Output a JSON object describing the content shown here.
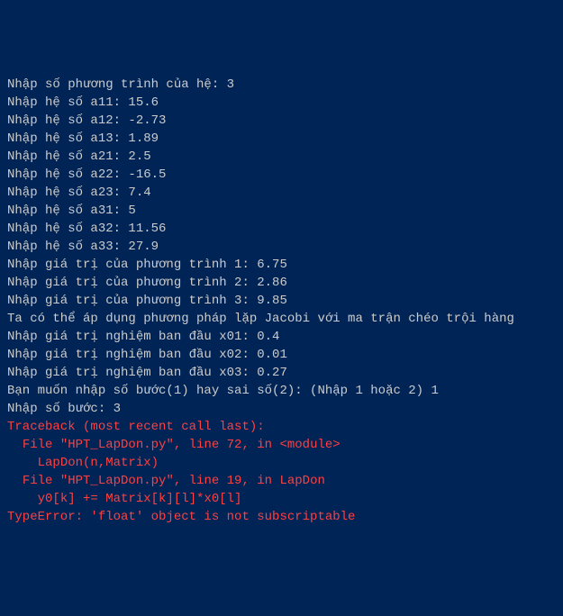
{
  "lines": [
    {
      "text": "Nhập số phương trình của hệ: 3",
      "color": "normal"
    },
    {
      "text": "Nhập hệ số a11: 15.6",
      "color": "normal"
    },
    {
      "text": "Nhập hệ số a12: -2.73",
      "color": "normal"
    },
    {
      "text": "Nhập hệ số a13: 1.89",
      "color": "normal"
    },
    {
      "text": "Nhập hệ số a21: 2.5",
      "color": "normal"
    },
    {
      "text": "Nhập hệ số a22: -16.5",
      "color": "normal"
    },
    {
      "text": "Nhập hệ số a23: 7.4",
      "color": "normal"
    },
    {
      "text": "Nhập hệ số a31: 5",
      "color": "normal"
    },
    {
      "text": "Nhập hệ số a32: 11.56",
      "color": "normal"
    },
    {
      "text": "Nhập hệ số a33: 27.9",
      "color": "normal"
    },
    {
      "text": "Nhập giá trị của phương trình 1: 6.75",
      "color": "normal"
    },
    {
      "text": "Nhập giá trị của phương trình 2: 2.86",
      "color": "normal"
    },
    {
      "text": "Nhập giá trị của phương trình 3: 9.85",
      "color": "normal"
    },
    {
      "text": "Ta có thể áp dụng phương pháp lặp Jacobi với ma trận chéo trội hàng",
      "color": "normal"
    },
    {
      "text": "Nhập giá trị nghiệm ban đầu x01: 0.4",
      "color": "normal"
    },
    {
      "text": "Nhập giá trị nghiệm ban đầu x02: 0.01",
      "color": "normal"
    },
    {
      "text": "Nhập giá trị nghiệm ban đầu x03: 0.27",
      "color": "normal"
    },
    {
      "text": "Bạn muốn nhập số bước(1) hay sai số(2): (Nhập 1 hoặc 2) 1",
      "color": "normal"
    },
    {
      "text": "Nhập số bước: 3",
      "color": "normal"
    },
    {
      "text": "Traceback (most recent call last):",
      "color": "error"
    },
    {
      "text": "  File \"HPT_LapDon.py\", line 72, in <module>",
      "color": "error"
    },
    {
      "text": "    LapDon(n,Matrix)",
      "color": "error"
    },
    {
      "text": "  File \"HPT_LapDon.py\", line 19, in LapDon",
      "color": "error"
    },
    {
      "text": "    y0[k] += Matrix[k][l]*x0[l]",
      "color": "error"
    },
    {
      "text": "TypeError: 'float' object is not subscriptable",
      "color": "error"
    }
  ]
}
